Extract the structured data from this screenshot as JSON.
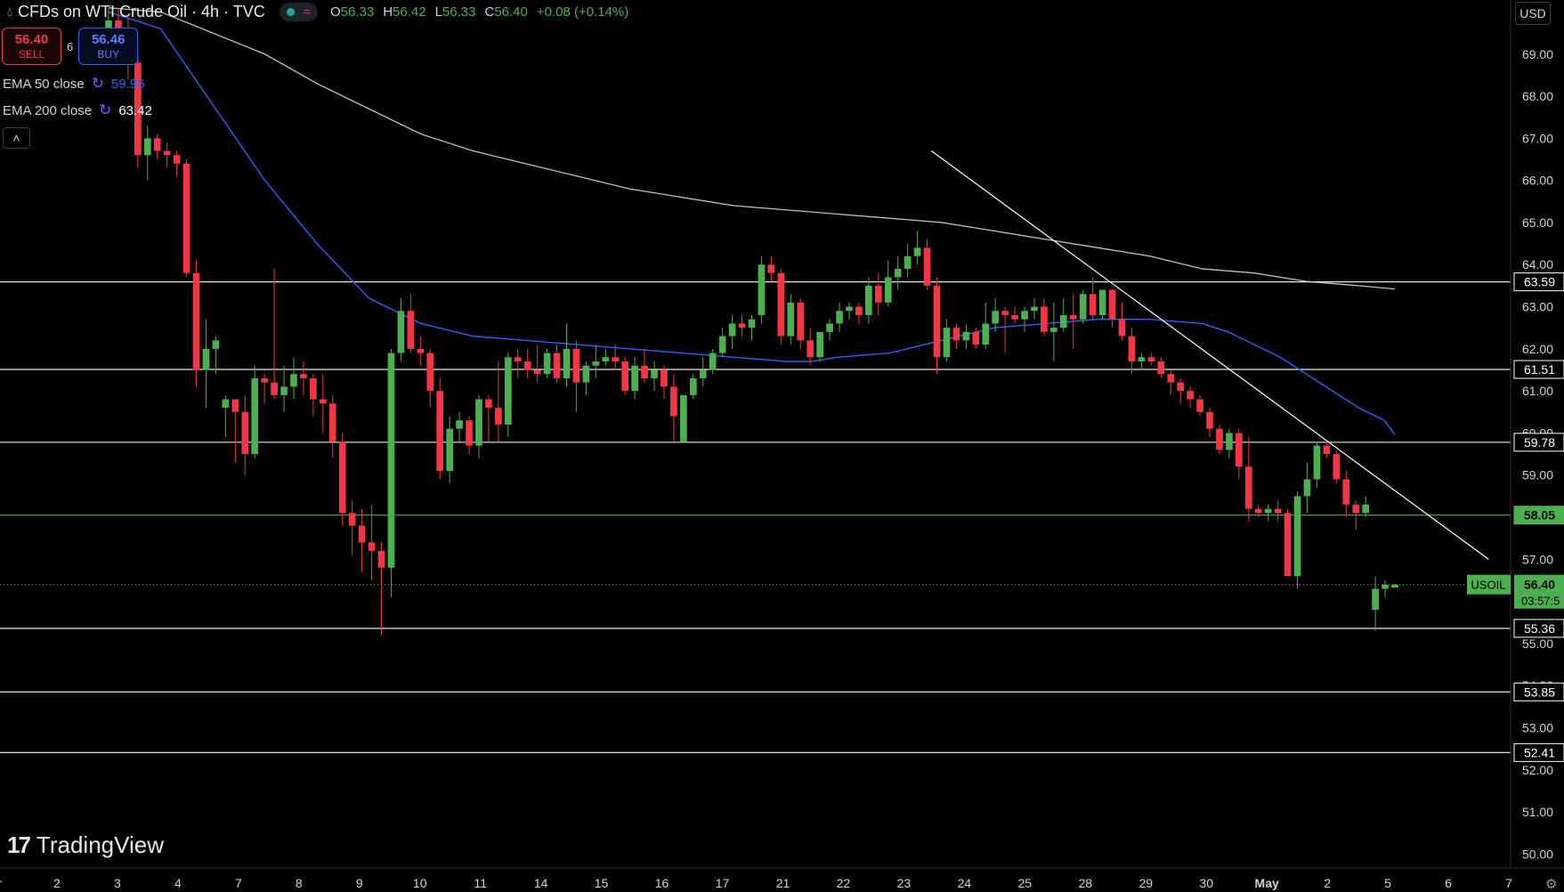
{
  "header": {
    "title": "CFDs on WTI Crude Oil · 4h · TVC",
    "ohlc": [
      {
        "key": "O",
        "value": "56.33"
      },
      {
        "key": "H",
        "value": "56.42"
      },
      {
        "key": "L",
        "value": "56.33"
      },
      {
        "key": "C",
        "value": "56.40"
      }
    ],
    "change": "+0.08 (+0.14%)"
  },
  "trade": {
    "sell_price": "56.40",
    "sell_label": "SELL",
    "spread": "6",
    "buy_price": "56.46",
    "buy_label": "BUY"
  },
  "indicators": [
    {
      "name": "EMA 50 close",
      "value": "59.96",
      "color": "#2962ff"
    },
    {
      "name": "EMA 200 close",
      "value": "63.42",
      "color": "#ffffff"
    }
  ],
  "currency": "USD",
  "branding": "TradingView",
  "colors": {
    "up": "#4caf50",
    "down": "#f23645",
    "ema50": "#2962ff",
    "ema200": "#e0e0e0",
    "accent": "#4caf50"
  },
  "chart_data": {
    "type": "candlestick",
    "symbol": "USOIL",
    "timeframe": "4h",
    "last_price": 56.4,
    "countdown": "03:57:5",
    "ylim": [
      49.5,
      70.2
    ],
    "y_ticks": [
      50.0,
      51.0,
      52.0,
      53.0,
      54.0,
      55.0,
      56.0,
      57.0,
      58.0,
      59.0,
      60.0,
      61.0,
      62.0,
      63.0,
      64.0,
      65.0,
      66.0,
      67.0,
      68.0,
      69.0
    ],
    "x_labels": [
      "pr",
      "2",
      "3",
      "4",
      "7",
      "8",
      "9",
      "10",
      "11",
      "14",
      "15",
      "16",
      "17",
      "21",
      "22",
      "23",
      "24",
      "25",
      "28",
      "29",
      "30",
      "May",
      "2",
      "5",
      "6",
      "7"
    ],
    "levels": [
      {
        "value": 63.59,
        "label": "63.59",
        "color": "#ffffff"
      },
      {
        "value": 61.51,
        "label": "61.51",
        "color": "#ffffff"
      },
      {
        "value": 59.78,
        "label": "59.78",
        "color": "#ffffff"
      },
      {
        "value": 58.05,
        "label": "58.05",
        "color": "#4caf50"
      },
      {
        "value": 55.36,
        "label": "55.36",
        "color": "#ffffff"
      },
      {
        "value": 53.85,
        "label": "53.85",
        "color": "#ffffff"
      },
      {
        "value": 52.41,
        "label": "52.41",
        "color": "#ffffff"
      }
    ],
    "candles": [
      {
        "o": 69.5,
        "h": 70.1,
        "l": 69.0,
        "c": 69.8
      },
      {
        "o": 69.8,
        "h": 70.1,
        "l": 69.3,
        "c": 69.5
      },
      {
        "o": 69.5,
        "h": 69.9,
        "l": 68.4,
        "c": 68.8
      },
      {
        "o": 68.8,
        "h": 69.0,
        "l": 66.3,
        "c": 66.6
      },
      {
        "o": 66.6,
        "h": 67.3,
        "l": 66.0,
        "c": 67.0
      },
      {
        "o": 67.0,
        "h": 67.1,
        "l": 66.5,
        "c": 66.7
      },
      {
        "o": 66.7,
        "h": 66.9,
        "l": 66.3,
        "c": 66.6
      },
      {
        "o": 66.6,
        "h": 66.7,
        "l": 66.1,
        "c": 66.4
      },
      {
        "o": 66.4,
        "h": 66.5,
        "l": 63.7,
        "c": 63.8
      },
      {
        "o": 63.8,
        "h": 64.1,
        "l": 61.1,
        "c": 61.5
      },
      {
        "o": 61.5,
        "h": 62.7,
        "l": 60.6,
        "c": 62.0
      },
      {
        "o": 62.0,
        "h": 62.3,
        "l": 61.4,
        "c": 62.2
      },
      {
        "o": 60.6,
        "h": 60.9,
        "l": 59.9,
        "c": 60.8
      },
      {
        "o": 60.8,
        "h": 60.8,
        "l": 59.3,
        "c": 60.5
      },
      {
        "o": 60.5,
        "h": 60.9,
        "l": 59.0,
        "c": 59.5
      },
      {
        "o": 59.5,
        "h": 61.6,
        "l": 59.4,
        "c": 61.3
      },
      {
        "o": 61.3,
        "h": 61.4,
        "l": 60.7,
        "c": 61.2
      },
      {
        "o": 61.2,
        "h": 63.9,
        "l": 60.8,
        "c": 60.9
      },
      {
        "o": 60.9,
        "h": 61.6,
        "l": 60.5,
        "c": 61.1
      },
      {
        "o": 61.1,
        "h": 61.8,
        "l": 60.8,
        "c": 61.4
      },
      {
        "o": 61.4,
        "h": 61.7,
        "l": 60.9,
        "c": 61.3
      },
      {
        "o": 61.3,
        "h": 61.4,
        "l": 60.4,
        "c": 60.8
      },
      {
        "o": 60.8,
        "h": 61.4,
        "l": 60.0,
        "c": 60.7
      },
      {
        "o": 60.7,
        "h": 60.9,
        "l": 59.4,
        "c": 59.8
      },
      {
        "o": 59.8,
        "h": 60.0,
        "l": 57.8,
        "c": 58.1
      },
      {
        "o": 58.1,
        "h": 58.4,
        "l": 57.1,
        "c": 57.8
      },
      {
        "o": 57.8,
        "h": 58.2,
        "l": 56.7,
        "c": 57.4
      },
      {
        "o": 57.4,
        "h": 58.3,
        "l": 56.5,
        "c": 57.2
      },
      {
        "o": 57.2,
        "h": 57.4,
        "l": 55.2,
        "c": 56.8
      },
      {
        "o": 56.8,
        "h": 62.0,
        "l": 56.1,
        "c": 61.9
      },
      {
        "o": 61.9,
        "h": 63.2,
        "l": 61.7,
        "c": 62.9
      },
      {
        "o": 62.9,
        "h": 63.3,
        "l": 61.9,
        "c": 62.0
      },
      {
        "o": 62.0,
        "h": 62.3,
        "l": 61.6,
        "c": 61.9
      },
      {
        "o": 61.9,
        "h": 62.0,
        "l": 60.6,
        "c": 61.0
      },
      {
        "o": 61.0,
        "h": 61.3,
        "l": 58.9,
        "c": 59.1
      },
      {
        "o": 59.1,
        "h": 60.4,
        "l": 58.8,
        "c": 60.1
      },
      {
        "o": 60.1,
        "h": 60.5,
        "l": 59.8,
        "c": 60.3
      },
      {
        "o": 60.3,
        "h": 60.4,
        "l": 59.5,
        "c": 59.7
      },
      {
        "o": 59.7,
        "h": 60.9,
        "l": 59.4,
        "c": 60.8
      },
      {
        "o": 60.8,
        "h": 60.9,
        "l": 59.8,
        "c": 60.6
      },
      {
        "o": 60.6,
        "h": 61.7,
        "l": 59.8,
        "c": 60.2
      },
      {
        "o": 60.2,
        "h": 61.9,
        "l": 59.9,
        "c": 61.8
      },
      {
        "o": 61.8,
        "h": 62.0,
        "l": 61.3,
        "c": 61.7
      },
      {
        "o": 61.7,
        "h": 62.0,
        "l": 61.3,
        "c": 61.5
      },
      {
        "o": 61.5,
        "h": 62.1,
        "l": 61.2,
        "c": 61.4
      },
      {
        "o": 61.4,
        "h": 62.0,
        "l": 61.3,
        "c": 61.9
      },
      {
        "o": 61.9,
        "h": 62.1,
        "l": 61.2,
        "c": 61.3
      },
      {
        "o": 61.3,
        "h": 62.6,
        "l": 61.1,
        "c": 62.0
      },
      {
        "o": 62.0,
        "h": 62.2,
        "l": 60.5,
        "c": 61.2
      },
      {
        "o": 61.2,
        "h": 61.7,
        "l": 60.9,
        "c": 61.6
      },
      {
        "o": 61.6,
        "h": 62.1,
        "l": 61.3,
        "c": 61.7
      },
      {
        "o": 61.7,
        "h": 62.0,
        "l": 61.6,
        "c": 61.8
      },
      {
        "o": 61.8,
        "h": 62.1,
        "l": 61.5,
        "c": 61.7
      },
      {
        "o": 61.7,
        "h": 61.8,
        "l": 60.9,
        "c": 61.0
      },
      {
        "o": 61.0,
        "h": 61.8,
        "l": 60.8,
        "c": 61.6
      },
      {
        "o": 61.6,
        "h": 62.0,
        "l": 61.2,
        "c": 61.3
      },
      {
        "o": 61.3,
        "h": 61.7,
        "l": 61.0,
        "c": 61.5
      },
      {
        "o": 61.5,
        "h": 61.6,
        "l": 60.8,
        "c": 61.1
      },
      {
        "o": 61.1,
        "h": 61.4,
        "l": 59.8,
        "c": 60.4
      },
      {
        "o": 59.8,
        "h": 60.9,
        "l": 59.8,
        "c": 60.9
      },
      {
        "o": 60.9,
        "h": 61.4,
        "l": 60.8,
        "c": 61.3
      },
      {
        "o": 61.3,
        "h": 61.8,
        "l": 61.1,
        "c": 61.5
      },
      {
        "o": 61.5,
        "h": 62.0,
        "l": 61.4,
        "c": 61.9
      },
      {
        "o": 61.9,
        "h": 62.5,
        "l": 61.8,
        "c": 62.3
      },
      {
        "o": 62.3,
        "h": 62.8,
        "l": 62.0,
        "c": 62.6
      },
      {
        "o": 62.6,
        "h": 62.8,
        "l": 62.3,
        "c": 62.5
      },
      {
        "o": 62.5,
        "h": 62.8,
        "l": 62.2,
        "c": 62.7
      },
      {
        "o": 62.8,
        "h": 64.2,
        "l": 62.6,
        "c": 64.0
      },
      {
        "o": 64.0,
        "h": 64.2,
        "l": 63.6,
        "c": 63.8
      },
      {
        "o": 63.8,
        "h": 63.9,
        "l": 62.1,
        "c": 62.3
      },
      {
        "o": 62.3,
        "h": 63.3,
        "l": 62.1,
        "c": 63.1
      },
      {
        "o": 63.1,
        "h": 63.2,
        "l": 62.0,
        "c": 62.2
      },
      {
        "o": 62.2,
        "h": 62.5,
        "l": 61.6,
        "c": 61.8
      },
      {
        "o": 61.8,
        "h": 62.4,
        "l": 61.7,
        "c": 62.4
      },
      {
        "o": 62.4,
        "h": 62.7,
        "l": 62.2,
        "c": 62.6
      },
      {
        "o": 62.6,
        "h": 63.1,
        "l": 62.4,
        "c": 62.9
      },
      {
        "o": 62.9,
        "h": 63.1,
        "l": 62.7,
        "c": 63.0
      },
      {
        "o": 63.0,
        "h": 63.1,
        "l": 62.6,
        "c": 62.8
      },
      {
        "o": 62.8,
        "h": 63.7,
        "l": 62.6,
        "c": 63.5
      },
      {
        "o": 63.5,
        "h": 63.8,
        "l": 62.8,
        "c": 63.1
      },
      {
        "o": 63.1,
        "h": 64.1,
        "l": 63.0,
        "c": 63.7
      },
      {
        "o": 63.7,
        "h": 64.2,
        "l": 63.4,
        "c": 63.9
      },
      {
        "o": 63.9,
        "h": 64.5,
        "l": 63.7,
        "c": 64.2
      },
      {
        "o": 64.2,
        "h": 64.8,
        "l": 64.0,
        "c": 64.4
      },
      {
        "o": 64.4,
        "h": 64.6,
        "l": 63.4,
        "c": 63.5
      },
      {
        "o": 63.5,
        "h": 63.7,
        "l": 61.4,
        "c": 61.8
      },
      {
        "o": 61.8,
        "h": 62.7,
        "l": 61.7,
        "c": 62.5
      },
      {
        "o": 62.5,
        "h": 62.6,
        "l": 62.0,
        "c": 62.2
      },
      {
        "o": 62.2,
        "h": 62.6,
        "l": 62.0,
        "c": 62.4
      },
      {
        "o": 62.4,
        "h": 62.5,
        "l": 62.0,
        "c": 62.1
      },
      {
        "o": 62.1,
        "h": 63.1,
        "l": 62.0,
        "c": 62.6
      },
      {
        "o": 62.6,
        "h": 63.2,
        "l": 62.4,
        "c": 62.9
      },
      {
        "o": 62.9,
        "h": 63.0,
        "l": 61.9,
        "c": 62.8
      },
      {
        "o": 62.8,
        "h": 63.0,
        "l": 62.6,
        "c": 62.7
      },
      {
        "o": 62.7,
        "h": 63.0,
        "l": 62.4,
        "c": 62.9
      },
      {
        "o": 62.9,
        "h": 63.2,
        "l": 62.7,
        "c": 63.0
      },
      {
        "o": 63.0,
        "h": 63.2,
        "l": 62.3,
        "c": 62.4
      },
      {
        "o": 62.4,
        "h": 63.1,
        "l": 61.7,
        "c": 62.5
      },
      {
        "o": 62.5,
        "h": 63.2,
        "l": 62.4,
        "c": 62.8
      },
      {
        "o": 62.8,
        "h": 63.3,
        "l": 62.0,
        "c": 62.7
      },
      {
        "o": 62.7,
        "h": 63.4,
        "l": 62.6,
        "c": 63.3
      },
      {
        "o": 63.3,
        "h": 63.7,
        "l": 62.7,
        "c": 62.8
      },
      {
        "o": 62.8,
        "h": 63.4,
        "l": 62.7,
        "c": 63.4
      },
      {
        "o": 63.4,
        "h": 63.4,
        "l": 62.5,
        "c": 62.7
      },
      {
        "o": 62.7,
        "h": 63.1,
        "l": 62.2,
        "c": 62.3
      },
      {
        "o": 62.3,
        "h": 62.5,
        "l": 61.4,
        "c": 61.7
      },
      {
        "o": 61.7,
        "h": 61.9,
        "l": 61.5,
        "c": 61.8
      },
      {
        "o": 61.8,
        "h": 61.9,
        "l": 61.6,
        "c": 61.7
      },
      {
        "o": 61.7,
        "h": 61.8,
        "l": 61.3,
        "c": 61.4
      },
      {
        "o": 61.4,
        "h": 61.5,
        "l": 60.9,
        "c": 61.2
      },
      {
        "o": 61.2,
        "h": 61.3,
        "l": 60.7,
        "c": 61.0
      },
      {
        "o": 61.0,
        "h": 61.1,
        "l": 60.6,
        "c": 60.8
      },
      {
        "o": 60.8,
        "h": 60.9,
        "l": 60.4,
        "c": 60.5
      },
      {
        "o": 60.5,
        "h": 60.6,
        "l": 59.9,
        "c": 60.1
      },
      {
        "o": 60.1,
        "h": 60.2,
        "l": 59.5,
        "c": 59.6
      },
      {
        "o": 59.6,
        "h": 60.1,
        "l": 59.4,
        "c": 60.0
      },
      {
        "o": 60.0,
        "h": 60.1,
        "l": 58.9,
        "c": 59.2
      },
      {
        "o": 59.2,
        "h": 59.9,
        "l": 57.9,
        "c": 58.2
      },
      {
        "o": 58.2,
        "h": 58.3,
        "l": 58.0,
        "c": 58.1
      },
      {
        "o": 58.1,
        "h": 58.3,
        "l": 57.9,
        "c": 58.2
      },
      {
        "o": 58.2,
        "h": 58.4,
        "l": 57.9,
        "c": 58.1
      },
      {
        "o": 58.1,
        "h": 58.2,
        "l": 57.1,
        "c": 56.6
      },
      {
        "o": 56.6,
        "h": 58.6,
        "l": 56.3,
        "c": 58.5
      },
      {
        "o": 58.5,
        "h": 59.3,
        "l": 58.1,
        "c": 58.9
      },
      {
        "o": 58.9,
        "h": 59.8,
        "l": 58.7,
        "c": 59.7
      },
      {
        "o": 59.7,
        "h": 59.8,
        "l": 59.4,
        "c": 59.5
      },
      {
        "o": 59.5,
        "h": 59.6,
        "l": 58.8,
        "c": 58.9
      },
      {
        "o": 58.9,
        "h": 59.1,
        "l": 58.0,
        "c": 58.3
      },
      {
        "o": 58.3,
        "h": 58.4,
        "l": 57.7,
        "c": 58.1
      },
      {
        "o": 58.1,
        "h": 58.5,
        "l": 58.0,
        "c": 58.3
      },
      {
        "o": 55.8,
        "h": 56.6,
        "l": 55.3,
        "c": 56.3
      },
      {
        "o": 56.3,
        "h": 56.5,
        "l": 56.1,
        "c": 56.4
      },
      {
        "o": 56.33,
        "h": 56.42,
        "l": 56.33,
        "c": 56.4
      }
    ],
    "ema50": [
      [
        0,
        70.0
      ],
      [
        10,
        69.6
      ],
      [
        20,
        67.8
      ],
      [
        30,
        66.0
      ],
      [
        40,
        64.5
      ],
      [
        50,
        63.2
      ],
      [
        60,
        62.6
      ],
      [
        70,
        62.3
      ],
      [
        80,
        62.2
      ],
      [
        90,
        62.1
      ],
      [
        100,
        62.0
      ],
      [
        110,
        61.9
      ],
      [
        120,
        61.8
      ],
      [
        130,
        61.7
      ],
      [
        135,
        61.7
      ],
      [
        140,
        61.8
      ],
      [
        150,
        61.9
      ],
      [
        160,
        62.2
      ],
      [
        170,
        62.5
      ],
      [
        180,
        62.6
      ],
      [
        190,
        62.7
      ],
      [
        200,
        62.7
      ],
      [
        210,
        62.6
      ],
      [
        215,
        62.4
      ],
      [
        220,
        62.1
      ],
      [
        225,
        61.8
      ],
      [
        230,
        61.4
      ],
      [
        235,
        61.0
      ],
      [
        240,
        60.6
      ],
      [
        245,
        60.3
      ],
      [
        247,
        59.96
      ]
    ],
    "ema200": [
      [
        0,
        70.1
      ],
      [
        10,
        70.0
      ],
      [
        20,
        69.5
      ],
      [
        30,
        69.0
      ],
      [
        40,
        68.3
      ],
      [
        50,
        67.7
      ],
      [
        60,
        67.1
      ],
      [
        70,
        66.7
      ],
      [
        80,
        66.4
      ],
      [
        90,
        66.1
      ],
      [
        100,
        65.8
      ],
      [
        110,
        65.6
      ],
      [
        120,
        65.4
      ],
      [
        130,
        65.3
      ],
      [
        140,
        65.2
      ],
      [
        150,
        65.1
      ],
      [
        160,
        65.0
      ],
      [
        170,
        64.8
      ],
      [
        180,
        64.6
      ],
      [
        190,
        64.4
      ],
      [
        200,
        64.2
      ],
      [
        210,
        63.9
      ],
      [
        220,
        63.8
      ],
      [
        230,
        63.6
      ],
      [
        240,
        63.5
      ],
      [
        247,
        63.42
      ]
    ],
    "trendline": [
      [
        158,
        66.7
      ],
      [
        265,
        57.0
      ]
    ]
  }
}
